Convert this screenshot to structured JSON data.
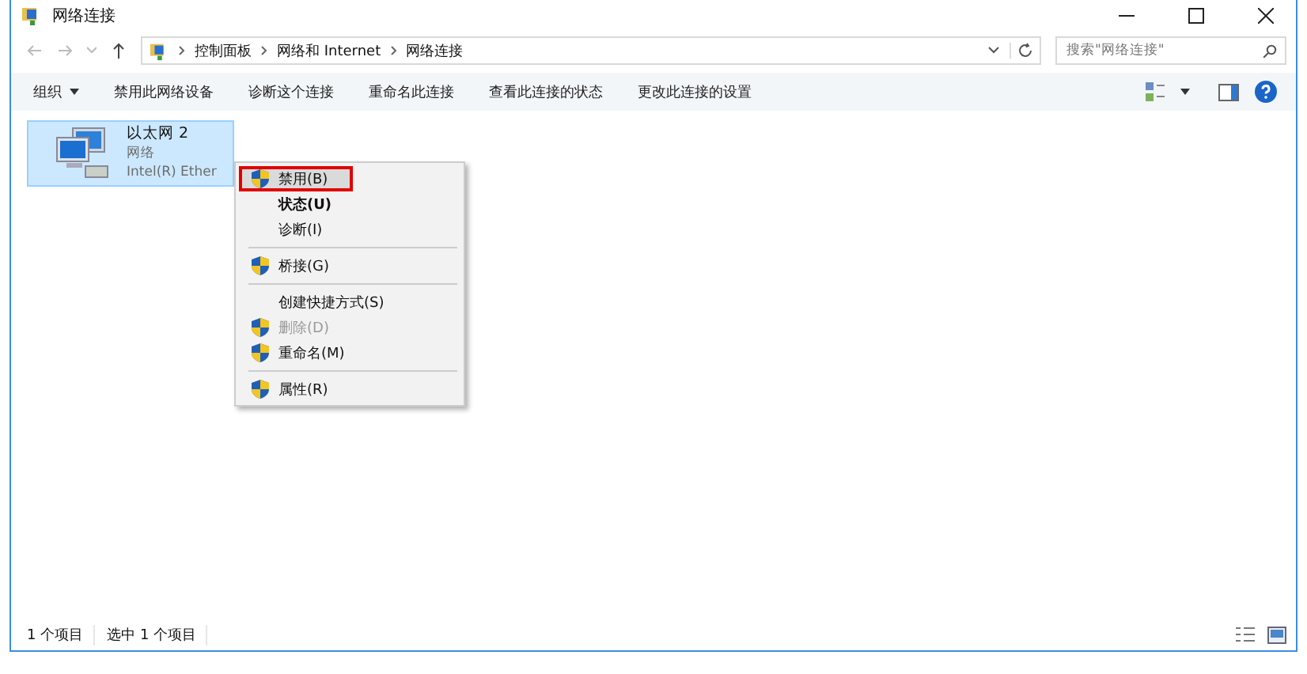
{
  "window": {
    "title": "网络连接"
  },
  "address": {
    "crumbs": [
      "控制面板",
      "网络和 Internet",
      "网络连接"
    ]
  },
  "search": {
    "placeholder": "搜索\"网络连接\""
  },
  "toolbar": {
    "items": [
      {
        "label": "组织",
        "dropdown": true
      },
      {
        "label": "禁用此网络设备",
        "dropdown": false
      },
      {
        "label": "诊断这个连接",
        "dropdown": false
      },
      {
        "label": "重命名此连接",
        "dropdown": false
      },
      {
        "label": "查看此连接的状态",
        "dropdown": false
      },
      {
        "label": "更改此连接的设置",
        "dropdown": false
      }
    ]
  },
  "connection": {
    "name": "以太网 2",
    "type": "网络",
    "adapter": "Intel(R) Ether",
    "selected": true
  },
  "context_menu": [
    {
      "kind": "item",
      "label": "禁用(B)",
      "shield": true,
      "bold": false,
      "disabled": false,
      "highlighted": true
    },
    {
      "kind": "item",
      "label": "状态(U)",
      "shield": false,
      "bold": true,
      "disabled": false,
      "highlighted": false
    },
    {
      "kind": "item",
      "label": "诊断(I)",
      "shield": false,
      "bold": false,
      "disabled": false,
      "highlighted": false
    },
    {
      "kind": "separator"
    },
    {
      "kind": "item",
      "label": "桥接(G)",
      "shield": true,
      "bold": false,
      "disabled": false,
      "highlighted": false
    },
    {
      "kind": "separator"
    },
    {
      "kind": "item",
      "label": "创建快捷方式(S)",
      "shield": false,
      "bold": false,
      "disabled": false,
      "highlighted": false
    },
    {
      "kind": "item",
      "label": "删除(D)",
      "shield": true,
      "bold": false,
      "disabled": true,
      "highlighted": false
    },
    {
      "kind": "item",
      "label": "重命名(M)",
      "shield": true,
      "bold": false,
      "disabled": false,
      "highlighted": false
    },
    {
      "kind": "separator"
    },
    {
      "kind": "item",
      "label": "属性(R)",
      "shield": true,
      "bold": false,
      "disabled": false,
      "highlighted": false
    }
  ],
  "status_bar": {
    "items": [
      "1 个项目",
      "选中 1 个项目"
    ]
  }
}
